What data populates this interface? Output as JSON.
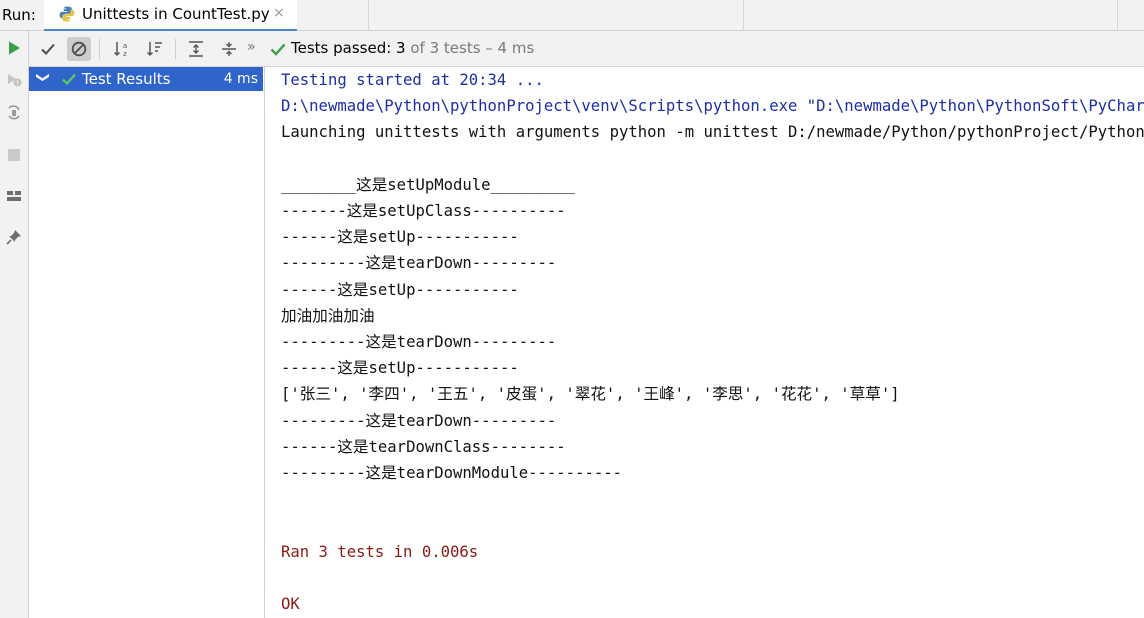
{
  "run_bar": {
    "label": "Run:",
    "tab_title": "Unittests in CountTest.py",
    "tab_close": "×",
    "icon": "python-icon"
  },
  "left_toolbar": [
    "rerun-icon",
    "rerun-failed-icon",
    "toggle-autotest-icon",
    "stop-icon",
    "layout-icon",
    "pin-icon"
  ],
  "toolbar": {
    "icons": [
      "show-passed-icon",
      "show-ignored-icon",
      "sort-alpha-icon",
      "sort-duration-icon",
      "expand-all-icon",
      "collapse-all-icon",
      "more-icon"
    ],
    "more": "»",
    "status_prefix": "Tests passed: ",
    "status_passed": "3",
    "status_rest": " of 3 tests – 4 ms"
  },
  "tree": {
    "chevron": "❯",
    "label": "Test Results",
    "time": "4 ms"
  },
  "console": {
    "lines": [
      {
        "text": "Testing started at 20:34 ...",
        "color": "blue"
      },
      {
        "text": "D:\\newmade\\Python\\pythonProject\\venv\\Scripts\\python.exe \"D:\\newmade\\Python\\PythonSoft\\PyCharm",
        "color": "blue"
      },
      {
        "text": "Launching unittests with arguments python -m unittest D:/newmade/Python/pythonProject/PythonLearn",
        "color": "black"
      },
      {
        "text": "",
        "color": "black"
      },
      {
        "text": "________这是setUpModule_________",
        "color": "black"
      },
      {
        "text": "-------这是setUpClass----------",
        "color": "black"
      },
      {
        "text": "------这是setUp-----------",
        "color": "black"
      },
      {
        "text": "---------这是tearDown---------",
        "color": "black"
      },
      {
        "text": "------这是setUp-----------",
        "color": "black"
      },
      {
        "text": "加油加油加油",
        "color": "black"
      },
      {
        "text": "---------这是tearDown---------",
        "color": "black"
      },
      {
        "text": "------这是setUp-----------",
        "color": "black"
      },
      {
        "text": "['张三', '李四', '王五', '皮蛋', '翠花', '王峰', '李思', '花花', '草草']",
        "color": "black"
      },
      {
        "text": "---------这是tearDown---------",
        "color": "black"
      },
      {
        "text": "------这是tearDownClass--------",
        "color": "black"
      },
      {
        "text": "---------这是tearDownModule----------",
        "color": "black"
      },
      {
        "text": "",
        "color": "black"
      },
      {
        "text": "",
        "color": "black"
      },
      {
        "text": "Ran 3 tests in 0.006s",
        "color": "red"
      },
      {
        "text": "",
        "color": "black"
      },
      {
        "text": "OK",
        "color": "red"
      }
    ]
  },
  "colors": {
    "accent": "#4a88c7",
    "selection": "#2f65ca",
    "pass_green": "#3e9c4a",
    "console_blue": "#1c2fa6",
    "console_red": "#8b1a14"
  }
}
